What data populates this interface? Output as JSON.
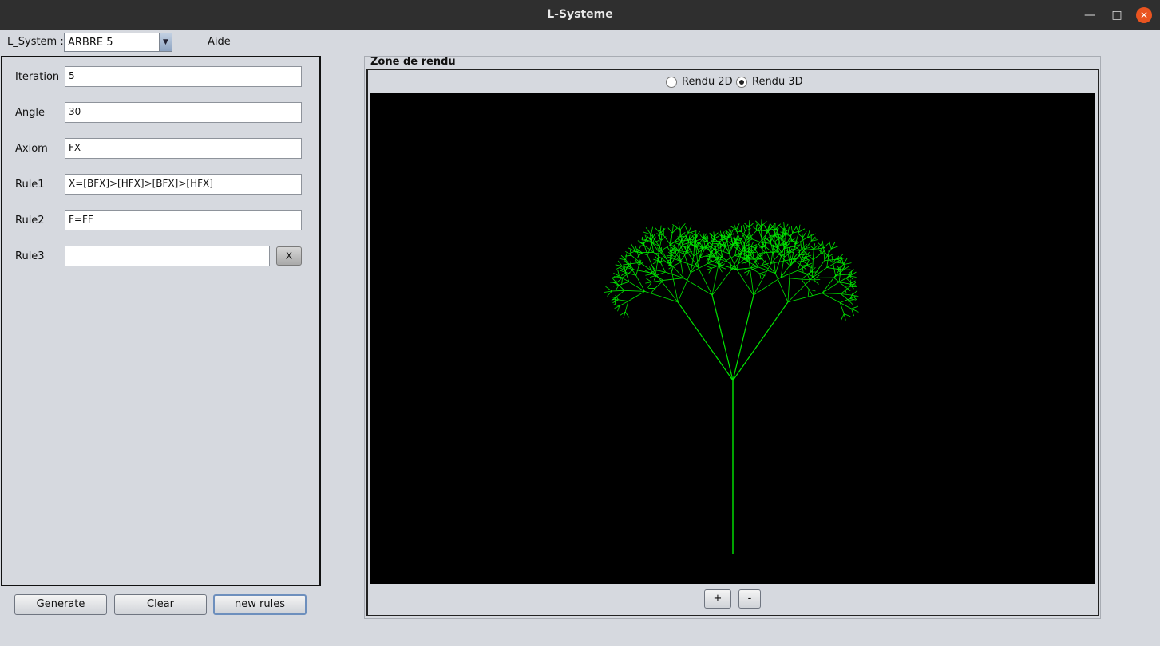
{
  "window": {
    "title": "L-Systeme"
  },
  "menubar": {
    "label": "L_System :",
    "selected": "ARBRE 5",
    "aide": "Aide"
  },
  "form": {
    "iteration": {
      "label": "Iteration",
      "value": "5"
    },
    "angle": {
      "label": "Angle",
      "value": "30"
    },
    "axiom": {
      "label": "Axiom",
      "value": "FX"
    },
    "rule1": {
      "label": "Rule1",
      "value": "X=[BFX]>[HFX]>[BFX]>[HFX]"
    },
    "rule2": {
      "label": "Rule2",
      "value": "F=FF"
    },
    "rule3": {
      "label": "Rule3",
      "value": "",
      "remove": "X"
    }
  },
  "buttons": {
    "generate": "Generate",
    "clear": "Clear",
    "new_rules": "new rules"
  },
  "render": {
    "title": "Zone de rendu",
    "mode_2d": "Rendu 2D",
    "mode_3d": "Rendu 3D",
    "selected_mode": "3D",
    "zoom_in": "+",
    "zoom_out": "-",
    "tree_color": "#00e600"
  }
}
